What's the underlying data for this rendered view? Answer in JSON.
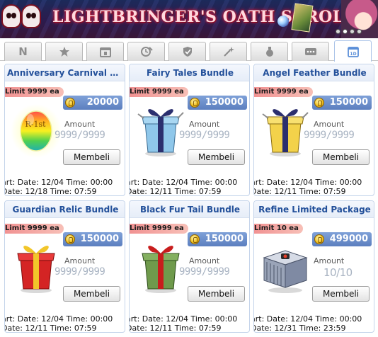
{
  "banner": {
    "title": "LIGHTBRINGER'S OATH SCROLL",
    "pager_dots": 4,
    "active_dot": 2
  },
  "tabs": [
    {
      "id": "n",
      "label": "N",
      "icon": "n-letter",
      "active": false
    },
    {
      "id": "favorite",
      "label": "",
      "icon": "star-icon",
      "active": false
    },
    {
      "id": "calendar",
      "label": "",
      "icon": "calendar-icon",
      "active": false
    },
    {
      "id": "time",
      "label": "",
      "icon": "clock-pen-icon",
      "active": false
    },
    {
      "id": "shield",
      "label": "",
      "icon": "shield-check-icon",
      "active": false
    },
    {
      "id": "sparkle",
      "label": "",
      "icon": "sparkle-wand-icon",
      "active": false
    },
    {
      "id": "potion",
      "label": "",
      "icon": "potion-icon",
      "active": false
    },
    {
      "id": "more",
      "label": "",
      "icon": "more-dots-icon",
      "active": false
    },
    {
      "id": "special",
      "label": "",
      "icon": "special-calendar-icon",
      "active": true
    }
  ],
  "colors": {
    "accent": "#5b8fd8",
    "card_title": "#23509a",
    "price_bg": "#6a8ecb",
    "limit_bg": "#f0a0a0"
  },
  "items": [
    {
      "title": "Anniversary Carnival S...",
      "limit": "Limit 9999 ea",
      "price": "20000",
      "amount_label": "Amount",
      "amount": "9999/9999",
      "button": "Membeli",
      "start": "art: Date: 12/04 Time: 00:00",
      "end": "Date: 12/18 Time: 07:59",
      "art": "egg"
    },
    {
      "title": "Fairy Tales Bundle",
      "limit": "Limit 9999 ea",
      "price": "150000",
      "amount_label": "Amount",
      "amount": "9999/9999",
      "button": "Membeli",
      "start": "art: Date: 12/04 Time: 00:00",
      "end": "Date: 12/11 Time: 07:59",
      "art": "gift-blue"
    },
    {
      "title": "Angel Feather Bundle",
      "limit": "Limit 9999 ea",
      "price": "150000",
      "amount_label": "Amount",
      "amount": "9999/9999",
      "button": "Membeli",
      "start": "art: Date: 12/04 Time: 00:00",
      "end": "Date: 12/11 Time: 07:59",
      "art": "gift-yellow"
    },
    {
      "title": "Guardian Relic Bundle",
      "limit": "Limit 9999 ea",
      "price": "150000",
      "amount_label": "Amount",
      "amount": "9999/9999",
      "button": "Membeli",
      "start": "art: Date: 12/04 Time: 00:00",
      "end": "Date: 12/11 Time: 07:59",
      "art": "gift-red"
    },
    {
      "title": "Black Fur Tail Bundle",
      "limit": "Limit 9999 ea",
      "price": "150000",
      "amount_label": "Amount",
      "amount": "9999/9999",
      "button": "Membeli",
      "start": "art: Date: 12/04 Time: 00:00",
      "end": "Date: 12/11 Time: 07:59",
      "art": "gift-green"
    },
    {
      "title": "Refine Limited Package",
      "limit": "Limit 10 ea",
      "price": "499000",
      "amount_label": "Amount",
      "amount": "10/10",
      "button": "Membeli",
      "start": "art: Date: 12/04 Time: 00:00",
      "end": "Date: 12/31 Time: 23:59",
      "art": "box"
    }
  ]
}
